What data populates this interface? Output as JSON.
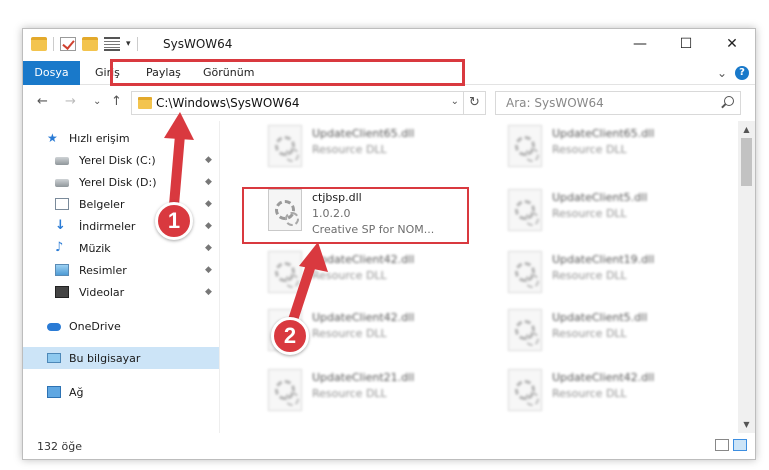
{
  "window": {
    "title": "SysWOW64",
    "controls": {
      "minimize": "—",
      "maximize": "☐",
      "close": "✕"
    }
  },
  "quick_access_toolbar": {
    "items": [
      "folder-icon",
      "properties-checkbox-icon",
      "new-folder-icon",
      "customize-icon"
    ],
    "dropdown": "▾"
  },
  "ribbon": {
    "tabs": [
      {
        "label": "Dosya",
        "active": true
      },
      {
        "label": "Giriş"
      },
      {
        "label": "Paylaş"
      },
      {
        "label": "Görünüm"
      }
    ],
    "expand": "⌄",
    "help": "?"
  },
  "navigation": {
    "back": "←",
    "forward": "→",
    "recent": "⌄",
    "up": "↑"
  },
  "address_bar": {
    "path": "C:\\Windows\\SysWOW64",
    "dropdown": "⌄",
    "refresh": "↻"
  },
  "search": {
    "placeholder": "Ara: SysWOW64"
  },
  "nav_pane": {
    "quick_access": "Hızlı erişim",
    "items": [
      {
        "label": "Yerel Disk (C:)",
        "icon": "disk-icon",
        "pinned": true
      },
      {
        "label": "Yerel Disk (D:)",
        "icon": "disk-icon",
        "pinned": true
      },
      {
        "label": "Belgeler",
        "icon": "documents-icon",
        "pinned": true
      },
      {
        "label": "İndirmeler",
        "icon": "downloads-icon",
        "pinned": true
      },
      {
        "label": "Müzik",
        "icon": "music-icon",
        "pinned": true
      },
      {
        "label": "Resimler",
        "icon": "pictures-icon",
        "pinned": true
      },
      {
        "label": "Videolar",
        "icon": "videos-icon",
        "pinned": true
      }
    ],
    "onedrive": "OneDrive",
    "this_pc": "Bu bilgisayar",
    "network": "Ağ",
    "pin_glyph": "📌"
  },
  "files": {
    "selected": {
      "name": "ctjbsp.dll",
      "version": "1.0.2.0",
      "description": "Creative SP for NOM..."
    },
    "left_column": [
      {
        "name": "UpdateClient65.dll",
        "desc": "Resource DLL"
      },
      {
        "name": "UpdateClient42.dll",
        "desc": "Resource DLL"
      },
      {
        "name": "UpdateClient42.dll",
        "desc": "Resource DLL"
      },
      {
        "name": "UpdateClient21.dll",
        "desc": "Resource DLL"
      }
    ],
    "right_column": [
      {
        "name": "UpdateClient65.dll",
        "desc": "Resource DLL"
      },
      {
        "name": "UpdateClient5.dll",
        "desc": "Resource DLL"
      },
      {
        "name": "UpdateClient19.dll",
        "desc": "Resource DLL"
      },
      {
        "name": "UpdateClient5.dll",
        "desc": "Resource DLL"
      },
      {
        "name": "UpdateClient42.dll",
        "desc": "Resource DLL"
      }
    ]
  },
  "status_bar": {
    "item_count": "132 öğe"
  },
  "callouts": {
    "step1": "1",
    "step2": "2",
    "color": "#d9393f"
  },
  "colors": {
    "accent": "#1979ca",
    "highlight": "#d9393f",
    "selection": "#cce4f7"
  }
}
